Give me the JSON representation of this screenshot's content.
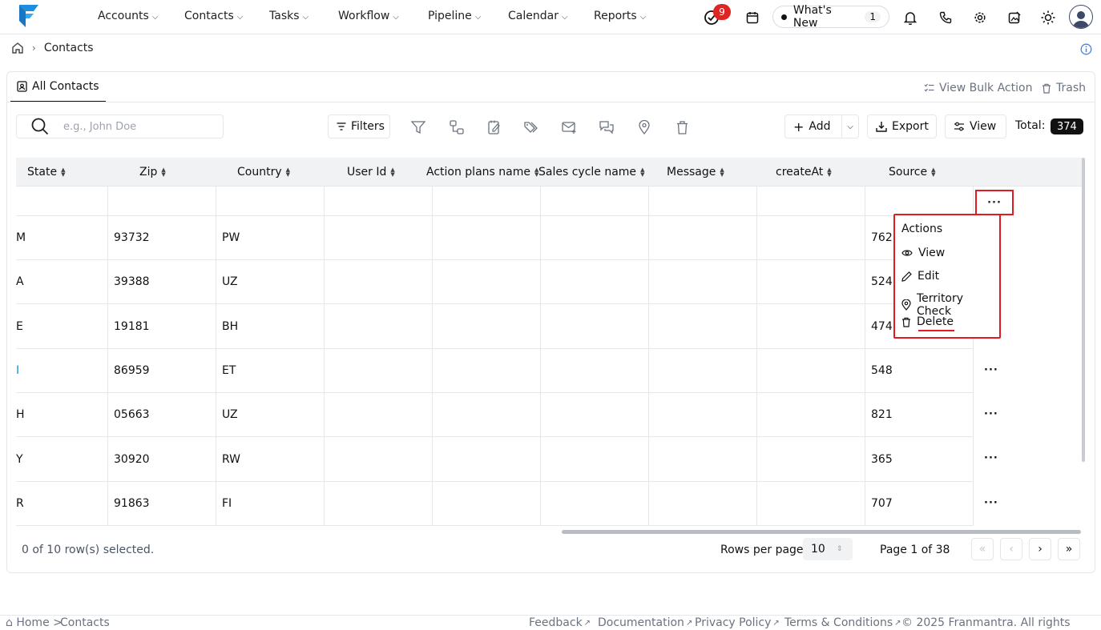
{
  "nav": {
    "items": [
      "Accounts",
      "Contacts",
      "Tasks",
      "Workflow",
      "Pipeline",
      "Calendar",
      "Reports"
    ],
    "notification_count": "9",
    "whats_new_label": "What's New",
    "whats_new_count": "1"
  },
  "breadcrumb": {
    "current": "Contacts"
  },
  "tabs": {
    "all_contacts": "All Contacts"
  },
  "actions": {
    "bulk": "View Bulk Action",
    "trash": "Trash"
  },
  "toolbar": {
    "search_placeholder": "e.g., John Doe",
    "filters_label": "Filters",
    "add_label": "Add",
    "export_label": "Export",
    "view_label": "View",
    "total_label": "Total:",
    "total_value": "374"
  },
  "table": {
    "headers": [
      "State",
      "Zip",
      "Country",
      "User Id",
      "Action plans name",
      "Sales cycle name",
      "Message",
      "createAt",
      "Source"
    ],
    "rows": [
      {
        "state": "",
        "zip": "",
        "country": "",
        "source": ""
      },
      {
        "state": "M",
        "zip": "93732",
        "country": "PW",
        "source": "762"
      },
      {
        "state": "A",
        "zip": "39388",
        "country": "UZ",
        "source": "524"
      },
      {
        "state": "E",
        "zip": "19181",
        "country": "BH",
        "source": "474"
      },
      {
        "state": "I",
        "zip": "86959",
        "country": "ET",
        "source": "548"
      },
      {
        "state": "H",
        "zip": "05663",
        "country": "UZ",
        "source": "821"
      },
      {
        "state": "Y",
        "zip": "30920",
        "country": "RW",
        "source": "365"
      },
      {
        "state": "R",
        "zip": "91863",
        "country": "FI",
        "source": "707"
      }
    ],
    "row_menu_label": "···"
  },
  "menu": {
    "title": "Actions",
    "items": [
      "View",
      "Edit",
      "Territory Check",
      "Delete"
    ]
  },
  "pagination": {
    "selected_info": "0 of 10 row(s) selected.",
    "rows_per_page_label": "Rows per page",
    "rows_per_page_value": "10",
    "page_info": "Page 1 of 38"
  },
  "footer": {
    "home": "⌂ Home >",
    "current": "Contacts",
    "links": [
      "Feedback",
      "Documentation",
      "Privacy Policy",
      "Terms & Conditions"
    ],
    "copyright": "© 2025 Franmantra. All rights reserved."
  },
  "colors": {
    "accent": "#1c8fe0",
    "highlight": "#e01b22",
    "badge": "#e02424"
  }
}
